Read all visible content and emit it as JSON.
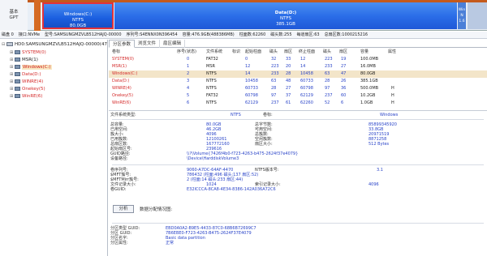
{
  "diskmap": {
    "disk_label_1": "基本",
    "disk_label_2": "GPT",
    "partitions": [
      {
        "name": "Windows(C:)",
        "fs": "NTFS",
        "size": "80.0GB"
      },
      {
        "name": "Data(D:)",
        "fs": "NTFS",
        "size": "385.1GB"
      },
      {
        "name": "Win",
        "fs": "N",
        "size": "1.6"
      }
    ]
  },
  "info_line": {
    "disk": "磁盘 0",
    "interface_label": "接口:",
    "interface": "NVMe",
    "model_label": "型号:",
    "model": "SAMSUNGMZVLB512HAJQ-00000",
    "serial_label": "序列号:",
    "serial": "S4ENNX0N396454",
    "capacity_label": "容量:",
    "capacity": "476.9GB(488386MB)",
    "cylinders_label": "柱面数:",
    "cylinders": "62260",
    "heads_label": "磁头数:",
    "heads": "255",
    "sectors_label": "每道扇区:",
    "sectors": "63",
    "total_label": "总扇区数:",
    "total": "1000215216"
  },
  "tree": {
    "disk": "HD0:SAMSUNGMZVLB512HAJQ-00000(47",
    "items": [
      "SYSTEM(0)",
      "MSR(1)",
      "Windows(C:)",
      "Data(D:)",
      "WINRE(4)",
      "Onekey(5)",
      "WinRE(6)"
    ]
  },
  "tabs": [
    "分区参数",
    "浏览文件",
    "扇区编辑"
  ],
  "ptable": {
    "headers": [
      "卷标",
      "序号(状态)",
      "文件系统",
      "标识",
      "起始柱面",
      "磁头",
      "扇区",
      "终止柱面",
      "磁头",
      "扇区",
      "容量",
      "属性"
    ],
    "rows": [
      {
        "name": "SYSTEM(0)",
        "idx": "0",
        "fs": "FAT32",
        "id": "",
        "sc": "0",
        "sh": "32",
        "ss": "33",
        "ec": "12",
        "eh": "223",
        "es": "19",
        "cap": "100.0MB",
        "attr": ""
      },
      {
        "name": "MSR(1)",
        "idx": "1",
        "fs": "MSR",
        "id": "",
        "sc": "12",
        "sh": "223",
        "ss": "20",
        "ec": "14",
        "eh": "233",
        "es": "27",
        "cap": "16.0MB",
        "attr": ""
      },
      {
        "name": "Windows(C:)",
        "idx": "2",
        "fs": "NTFS",
        "id": "",
        "sc": "14",
        "sh": "233",
        "ss": "28",
        "ec": "10458",
        "eh": "63",
        "es": "47",
        "cap": "80.0GB",
        "attr": ""
      },
      {
        "name": "Data(D:)",
        "idx": "3",
        "fs": "NTFS",
        "id": "",
        "sc": "10458",
        "sh": "63",
        "ss": "48",
        "ec": "60733",
        "eh": "28",
        "es": "26",
        "cap": "385.1GB",
        "attr": ""
      },
      {
        "name": "WINRE(4)",
        "idx": "4",
        "fs": "NTFS",
        "id": "",
        "sc": "60733",
        "sh": "28",
        "ss": "27",
        "ec": "60798",
        "eh": "97",
        "es": "36",
        "cap": "500.0MB",
        "attr": "H"
      },
      {
        "name": "Onekey(5)",
        "idx": "5",
        "fs": "FAT32",
        "id": "",
        "sc": "60798",
        "sh": "97",
        "ss": "37",
        "ec": "62129",
        "eh": "237",
        "es": "60",
        "cap": "10.2GB",
        "attr": "H"
      },
      {
        "name": "WinRE(6)",
        "idx": "6",
        "fs": "NTFS",
        "id": "",
        "sc": "62129",
        "sh": "237",
        "ss": "61",
        "ec": "62260",
        "eh": "52",
        "es": "6",
        "cap": "1.0GB",
        "attr": "H"
      }
    ]
  },
  "details": {
    "fs_type_label": "文件系统类型:",
    "fs_type": "NTFS",
    "vol_label_label": "卷标:",
    "vol_label": "Windows",
    "total_cap_label": "总容量:",
    "total_cap": "80.0GB",
    "total_bytes_label": "总字节数:",
    "total_bytes": "85899345920",
    "used_label": "已用空间:",
    "used": "46.2GB",
    "free_label": "可用空间:",
    "free": "33.8GB",
    "cluster_label": "簇大小:",
    "cluster": "4096",
    "total_clusters_label": "总簇数:",
    "total_clusters": "20971519",
    "used_clusters_label": "已用簇数:",
    "used_clusters": "12100261",
    "free_clusters_label": "空闲簇数:",
    "free_clusters": "8871258",
    "total_sectors_label": "总扇区数:",
    "total_sectors": "167772160",
    "sector_size_label": "扇区大小:",
    "sector_size": "512 Bytes",
    "start_sector_label": "起始扇区号:",
    "start_sector": "239616",
    "volume_path_label": "GUID路径:",
    "volume_path": "\\\\?\\Volume{7426f4b0-f723-4263-b475-2624f37e4079}",
    "device_path_label": "设备路径:",
    "device_path": "\\Device\\HarddiskVolume3",
    "serial_label": "卷序列号:",
    "serial": "9060-A7DC-64AF-4470",
    "ntfs_ver_label": "NTFS版本号:",
    "ntfs_ver": "3.1",
    "mft_label": "$MFT簇号:",
    "mft": "786432 (柱面:496 磁头:137 扇区:52)",
    "mftmirr_label": "$MFTMirr簇号:",
    "mftmirr": "2 (柱面:14 磁头:233 扇区:44)",
    "frs_label": "文件记录大小:",
    "frs": "1024",
    "index_label": "索引记录大小:",
    "index": "4096",
    "guid_label": "卷GUID:",
    "guid": "E32ICCCA-8CA8-4E34-8386-142A036A72C6",
    "analyze_button": "分析",
    "analysis_label": "数据分配情况图:",
    "type_guid_label": "分区类型 GUID:",
    "type_guid": "EBD0A0A2-B9E5-4433-87C0-68B6B72699C7",
    "part_guid_label": "分区 GUID:",
    "part_guid": "7B6EBE0-F723-4263-B475-2624F37E4079",
    "part_name_label": "分区名字:",
    "part_name": "Basic data partition",
    "part_attr_label": "分区属性:",
    "part_attr": "正常"
  }
}
